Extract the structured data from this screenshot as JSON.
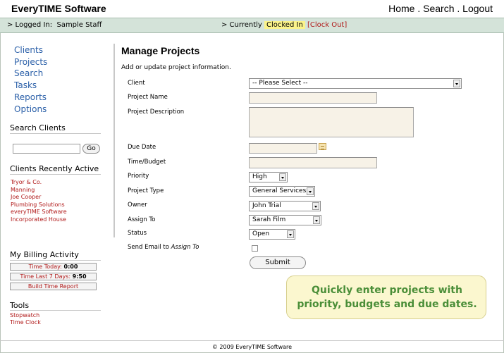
{
  "header": {
    "app_title": "EveryTIME Software",
    "nav": {
      "home": "Home",
      "search": "Search",
      "logout": "Logout",
      "sep": "."
    }
  },
  "status": {
    "logged_label": "> Logged In:",
    "user": "Sample Staff",
    "currently_label": "> Currently",
    "clocked_in": "Clocked In",
    "clock_out": "[Clock Out]"
  },
  "sidebar": {
    "nav": [
      "Clients",
      "Projects",
      "Search",
      "Tasks",
      "Reports",
      "Options"
    ],
    "search_heading": "Search Clients",
    "search_placeholder": "",
    "go_label": "Go",
    "recent_heading": "Clients Recently Active",
    "recent": [
      "Tryor & Co.",
      "Manning",
      "Joe Cooper",
      "Plumbing Solutions",
      "everyTIME Software",
      "Incorporated House"
    ],
    "billing_heading": "My Billing Activity",
    "billing": {
      "today_label": "Time Today:",
      "today_value": "0:00",
      "week_label": "Time Last 7 Days:",
      "week_value": "9:50",
      "report_label": "Build Time Report"
    },
    "tools_heading": "Tools",
    "tools": [
      "Stopwatch",
      "Time Clock"
    ]
  },
  "main": {
    "title": "Manage Projects",
    "description": "Add or update project information.",
    "form": {
      "client_label": "Client",
      "client_value": "-- Please Select --",
      "name_label": "Project Name",
      "name_value": "",
      "desc_label": "Project Description",
      "desc_value": "",
      "due_label": "Due Date",
      "due_value": "",
      "budget_label": "Time/Budget",
      "budget_value": "",
      "priority_label": "Priority",
      "priority_value": "High",
      "type_label": "Project Type",
      "type_value": "General Services",
      "owner_label": "Owner",
      "owner_value": "John Trial",
      "assign_label": "Assign To",
      "assign_value": "Sarah Film",
      "status_label": "Status",
      "status_value": "Open",
      "email_label": "Send Email to",
      "email_label_em": "Assign To",
      "email_checked": false,
      "submit_label": "Submit"
    }
  },
  "callout": {
    "line1": "Quickly enter projects with",
    "line2": "priority, budgets and due dates."
  },
  "footer": {
    "text": "© 2009 EveryTIME Software"
  },
  "colors": {
    "accent_link": "#2a5fa8",
    "link_red": "#b01818",
    "status_bar": "#d4e3d9",
    "clocked_highlight": "#fbf38a",
    "callout_text": "#4a8e38",
    "field_bg": "#f7f2e7"
  }
}
